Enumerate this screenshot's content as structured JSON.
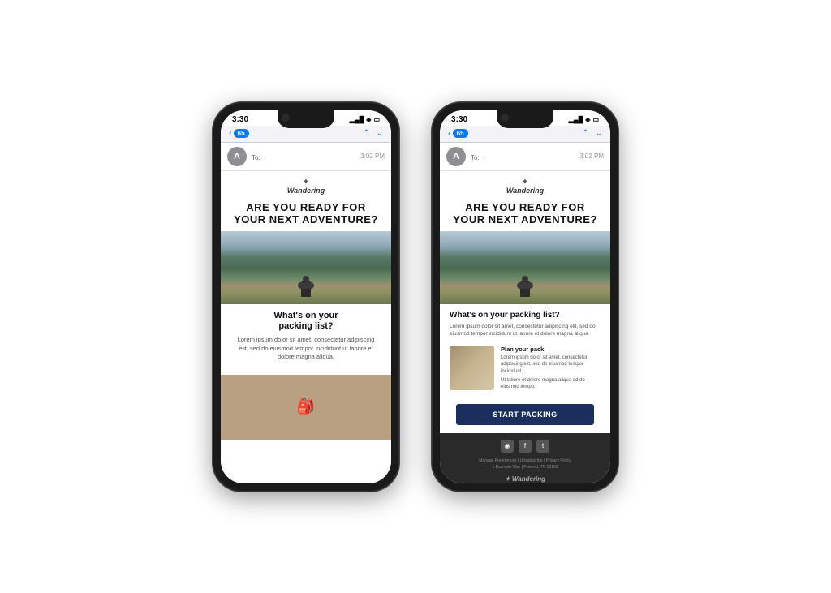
{
  "scene": {
    "background": "#ffffff"
  },
  "phone1": {
    "status": {
      "time": "3:30",
      "signal": "▂▄▆",
      "wifi": "WiFi",
      "battery": "Batt"
    },
    "mail_header": {
      "back_count": "65",
      "nav_up": "▲",
      "nav_down": "▼"
    },
    "sender": {
      "avatar_letter": "A",
      "to_label": "To:",
      "time": "3:02 PM"
    },
    "email": {
      "brand_logo": "☀",
      "brand_name": "Wandering",
      "headline_line1": "ARE YOU READY FOR",
      "headline_line2": "YOUR NEXT ADVENTURE?",
      "section_title_line1": "What's on your",
      "section_title_line2": "packing list?",
      "body_text": "Lorem ipsum dolor sit amet, consectetur adipiscing elit, sed do eiusmod tempor incididunt ut labore et dolore magna aliqua."
    }
  },
  "phone2": {
    "status": {
      "time": "3:30",
      "signal": "▂▄▆",
      "wifi": "WiFi",
      "battery": "Batt"
    },
    "mail_header": {
      "back_count": "65",
      "nav_up": "▲",
      "nav_down": "▼"
    },
    "sender": {
      "avatar_letter": "A",
      "to_label": "To:",
      "time": "3:02 PM"
    },
    "email": {
      "brand_logo": "☀",
      "brand_name": "Wandering",
      "headline_line1": "ARE YOU READY FOR",
      "headline_line2": "YOUR NEXT ADVENTURE?",
      "section_title": "What's on your packing list?",
      "section_body": "Lorem ipsum dolor sit amet, consectetur adipiscing elit, sed do eiusmod tempor incididunt ut labore et dolore magna aliqua.",
      "product_title": "Plan your pack.",
      "product_body_line1": "Lorem ipsum dolor sit amet, consectetur adipiscing elit, sed do eiusmod tempor incididunt.",
      "product_body_line2": "Ut labore et dolore magna aliqua ed do eiusmod tempo.",
      "cta_button": "Start Packing",
      "social_instagram": "◉",
      "social_facebook": "f",
      "social_twitter": "t",
      "footer_links": "Manage Preferences | Unsubscribe | Privacy Policy",
      "footer_address": "1 Example Way | Pretend, TN 38108",
      "footer_brand": "Wandering"
    }
  }
}
